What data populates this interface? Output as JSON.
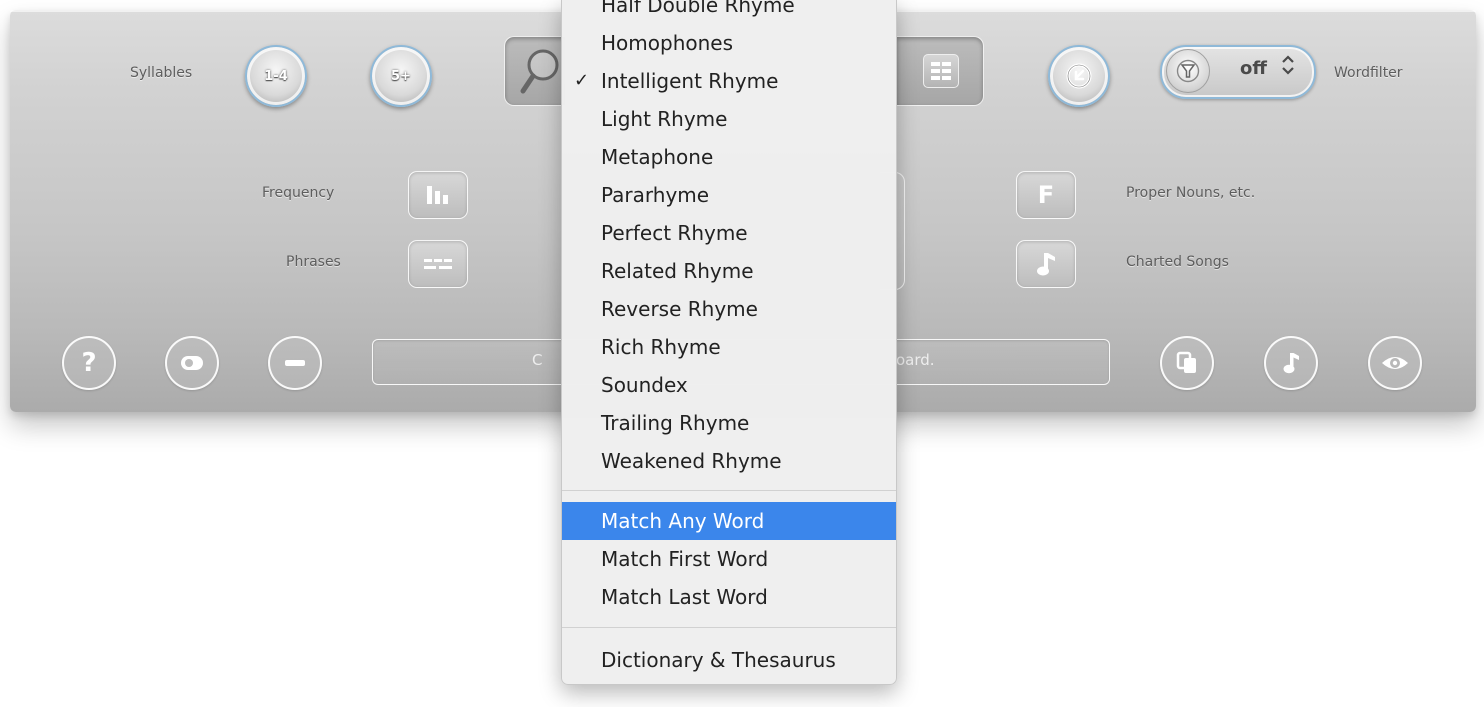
{
  "toolbar": {
    "syllables_label": "Syllables",
    "syllable_short": "1-4",
    "syllable_long": "5+",
    "wordfilter_label": "Wordfilter",
    "wordfilter_value": "off"
  },
  "options": {
    "frequency": "Frequency",
    "phrases": "Phrases",
    "proper_nouns": "Proper Nouns, etc.",
    "charted_songs": "Charted Songs",
    "proper_nouns_glyph": "F"
  },
  "bottom": {
    "help_glyph": "?",
    "field_hint_left": "C",
    "field_hint_right": "oard."
  },
  "menu": {
    "partial_item": "Half Double Rhyme",
    "rhyme_types": [
      {
        "label": "Homophones",
        "checked": false
      },
      {
        "label": "Intelligent Rhyme",
        "checked": true
      },
      {
        "label": "Light Rhyme",
        "checked": false
      },
      {
        "label": "Metaphone",
        "checked": false
      },
      {
        "label": "Pararhyme",
        "checked": false
      },
      {
        "label": "Perfect Rhyme",
        "checked": false
      },
      {
        "label": "Related Rhyme",
        "checked": false
      },
      {
        "label": "Reverse Rhyme",
        "checked": false
      },
      {
        "label": "Rich Rhyme",
        "checked": false
      },
      {
        "label": "Soundex",
        "checked": false
      },
      {
        "label": "Trailing Rhyme",
        "checked": false
      },
      {
        "label": "Weakened Rhyme",
        "checked": false
      }
    ],
    "check_glyph": "✓",
    "match_modes": [
      {
        "label": "Match Any Word",
        "highlighted": true
      },
      {
        "label": "Match First Word",
        "highlighted": false
      },
      {
        "label": "Match Last Word",
        "highlighted": false
      }
    ],
    "dictionary": "Dictionary & Thesaurus",
    "highlight_color": "#3b86eb"
  }
}
